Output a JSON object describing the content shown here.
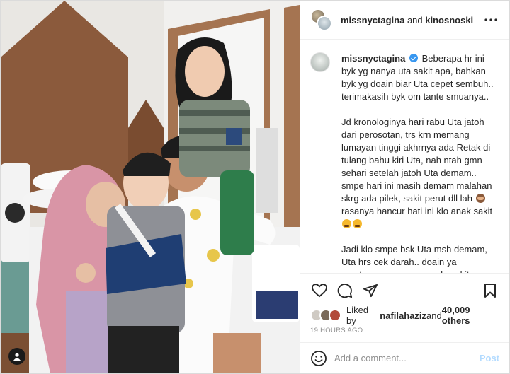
{
  "header": {
    "username": "missnyctagina",
    "connector": " and ",
    "collaborator": "kinosnoski",
    "more_icon": "more-horizontal-icon"
  },
  "caption": {
    "username": "missnyctagina",
    "verified_icon": "verified-badge-icon",
    "paragraph_1": "Beberapa hr ini byk yg nanya uta sakit apa, bahkan byk yg doain biar Uta cepet sembuh.. terimakasih byk om tante smuanya..",
    "paragraph_2a": "Jd kronologinya hari rabu Uta jatoh dari perosotan, trs krn memang lumayan tinggi akhrnya ada Retak di tulang bahu kiri Uta, nah ntah gmn sehari setelah jatoh Uta demam.. smpe hari ini masih demam malahan skrg ada pilek, sakit perut dll lah",
    "paragraph_2b": " rasanya hancur hati ini klo anak sakit",
    "paragraph_3": "Jadi klo smpe bsk Uta msh demam, Uta hrs cek darah.. doain ya mentemen supaya ga ada sakit yg aneh2 di badan Uta, biar Uta sehat, panjang umur dan selalu dalam lindungan AllahSWT"
  },
  "actions": {
    "like_icon": "heart-icon",
    "comment_icon": "comment-icon",
    "share_icon": "share-icon",
    "save_icon": "bookmark-icon"
  },
  "likes": {
    "prefix": "Liked by ",
    "user": "nafilahaziz",
    "middle": " and ",
    "count": "40,009 others"
  },
  "timestamp": "19 HOURS AGO",
  "comment": {
    "placeholder": "Add a comment...",
    "post_label": "Post",
    "emoji_icon": "emoji-smile-icon"
  },
  "photo": {
    "tag_icon": "user-tag-icon"
  }
}
